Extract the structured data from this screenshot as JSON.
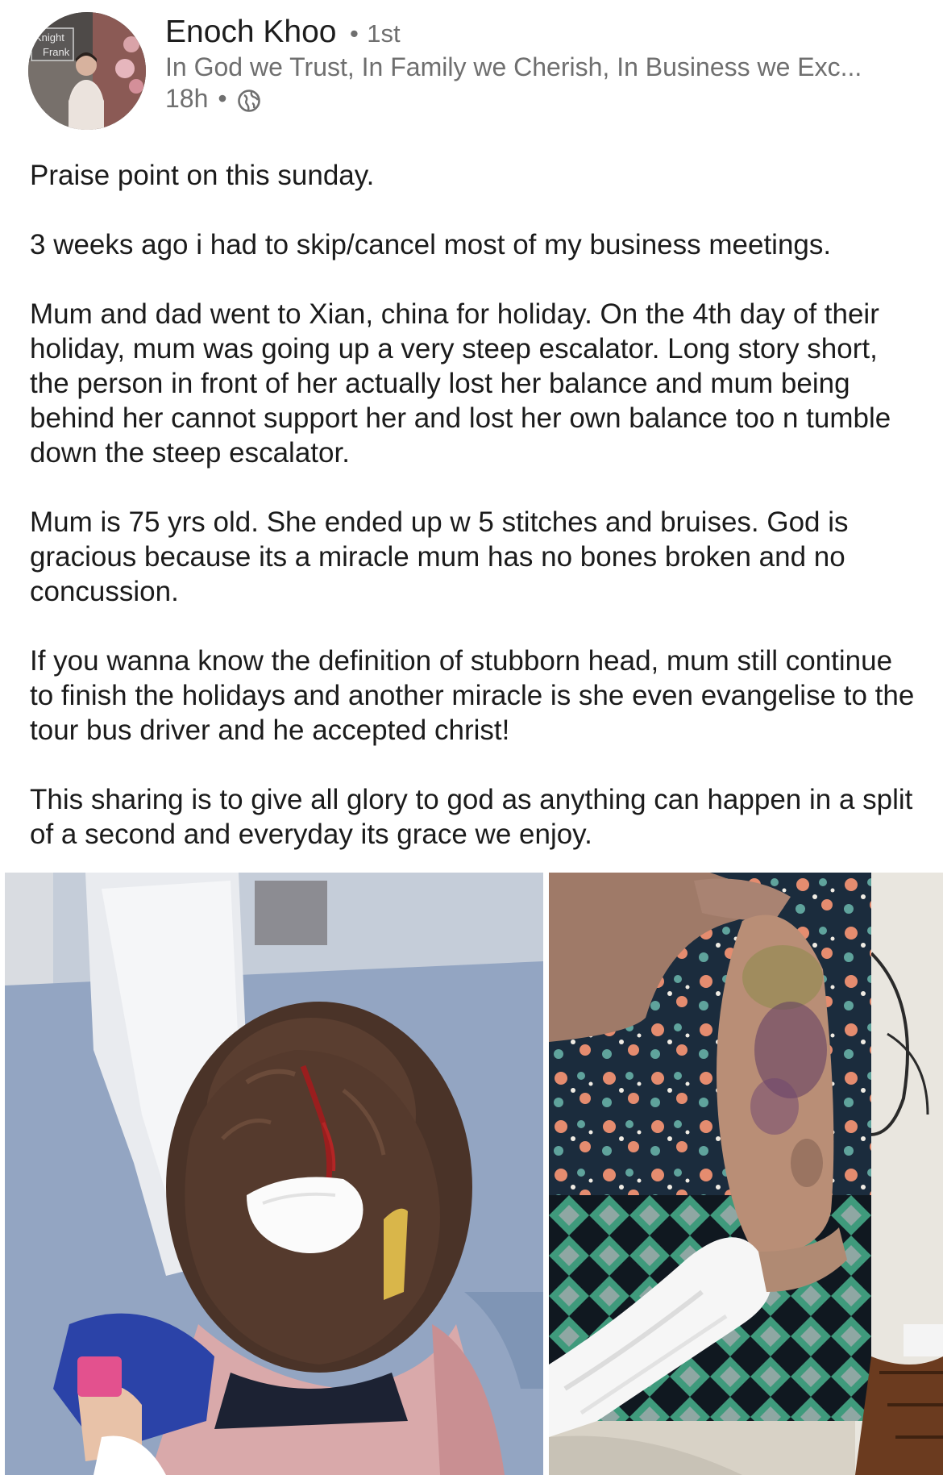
{
  "post": {
    "author": {
      "name": "Enoch Khoo",
      "separator": "•",
      "connection_degree": "1st",
      "headline": "In God we Trust, In Family we Cherish, In Business we Exc...",
      "avatar_sign_text": [
        "Knight",
        "Frank"
      ]
    },
    "meta": {
      "time": "18h",
      "separator": "•",
      "visibility_icon": "globe-icon"
    },
    "paragraphs": [
      "Praise point on this sunday.",
      "3 weeks ago i had to skip/cancel most of my business meetings.",
      "Mum and dad went to Xian, china for holiday. On the 4th day of their holiday, mum was going up a very steep escalator. Long story short, the person in front of her actually lost her balance and mum being behind her cannot support her and lost her own balance too n tumble down the steep escalator.",
      "Mum is 75 yrs old. She ended up w 5 stitches and bruises. God is gracious because its a miracle mum has no bones broken and no concussion.",
      "If you wanna know the definition of stubborn head, mum still continue to finish the holidays and another miracle is she even evangelise to the tour bus driver and he accepted christ!",
      "This sharing is to give all glory to god as anything can happen in a split of a second and everyday its grace we enjoy."
    ],
    "photos": [
      {
        "subject": "head-wound-photo"
      },
      {
        "subject": "bruised-arm-photo"
      }
    ]
  },
  "colors": {
    "primary_text": "#1b1b1b",
    "secondary_text": "#6f6f6f",
    "background": "#ffffff"
  }
}
